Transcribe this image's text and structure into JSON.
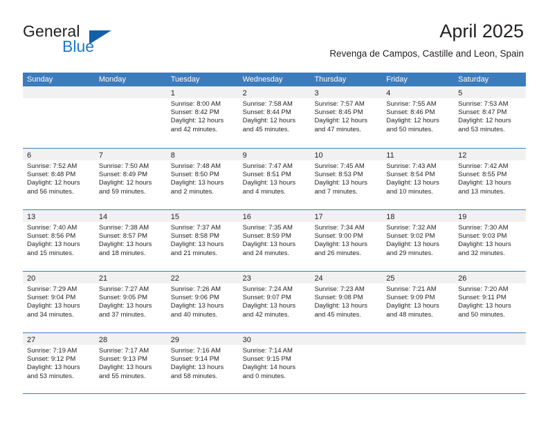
{
  "brand": {
    "name_part1": "General",
    "name_part2": "Blue",
    "triangle_icon": "triangle-icon",
    "accent_color": "#2079c4",
    "triangle_color": "#1260a8"
  },
  "header": {
    "title": "April 2025",
    "subtitle": "Revenga de Campos, Castille and Leon, Spain"
  },
  "theme": {
    "header_bg": "#3d7cbc",
    "header_text": "#ffffff",
    "daynum_band": "#f1f1f1",
    "border": "#3d7cbc"
  },
  "weekday_headers": [
    "Sunday",
    "Monday",
    "Tuesday",
    "Wednesday",
    "Thursday",
    "Friday",
    "Saturday"
  ],
  "weeks": [
    [
      {
        "day": "",
        "empty": true,
        "sunrise": "",
        "sunset": "",
        "daylight1": "",
        "daylight2": ""
      },
      {
        "day": "",
        "empty": true,
        "sunrise": "",
        "sunset": "",
        "daylight1": "",
        "daylight2": ""
      },
      {
        "day": "1",
        "empty": false,
        "sunrise": "Sunrise: 8:00 AM",
        "sunset": "Sunset: 8:42 PM",
        "daylight1": "Daylight: 12 hours",
        "daylight2": "and 42 minutes."
      },
      {
        "day": "2",
        "empty": false,
        "sunrise": "Sunrise: 7:58 AM",
        "sunset": "Sunset: 8:44 PM",
        "daylight1": "Daylight: 12 hours",
        "daylight2": "and 45 minutes."
      },
      {
        "day": "3",
        "empty": false,
        "sunrise": "Sunrise: 7:57 AM",
        "sunset": "Sunset: 8:45 PM",
        "daylight1": "Daylight: 12 hours",
        "daylight2": "and 47 minutes."
      },
      {
        "day": "4",
        "empty": false,
        "sunrise": "Sunrise: 7:55 AM",
        "sunset": "Sunset: 8:46 PM",
        "daylight1": "Daylight: 12 hours",
        "daylight2": "and 50 minutes."
      },
      {
        "day": "5",
        "empty": false,
        "sunrise": "Sunrise: 7:53 AM",
        "sunset": "Sunset: 8:47 PM",
        "daylight1": "Daylight: 12 hours",
        "daylight2": "and 53 minutes."
      }
    ],
    [
      {
        "day": "6",
        "empty": false,
        "sunrise": "Sunrise: 7:52 AM",
        "sunset": "Sunset: 8:48 PM",
        "daylight1": "Daylight: 12 hours",
        "daylight2": "and 56 minutes."
      },
      {
        "day": "7",
        "empty": false,
        "sunrise": "Sunrise: 7:50 AM",
        "sunset": "Sunset: 8:49 PM",
        "daylight1": "Daylight: 12 hours",
        "daylight2": "and 59 minutes."
      },
      {
        "day": "8",
        "empty": false,
        "sunrise": "Sunrise: 7:48 AM",
        "sunset": "Sunset: 8:50 PM",
        "daylight1": "Daylight: 13 hours",
        "daylight2": "and 2 minutes."
      },
      {
        "day": "9",
        "empty": false,
        "sunrise": "Sunrise: 7:47 AM",
        "sunset": "Sunset: 8:51 PM",
        "daylight1": "Daylight: 13 hours",
        "daylight2": "and 4 minutes."
      },
      {
        "day": "10",
        "empty": false,
        "sunrise": "Sunrise: 7:45 AM",
        "sunset": "Sunset: 8:53 PM",
        "daylight1": "Daylight: 13 hours",
        "daylight2": "and 7 minutes."
      },
      {
        "day": "11",
        "empty": false,
        "sunrise": "Sunrise: 7:43 AM",
        "sunset": "Sunset: 8:54 PM",
        "daylight1": "Daylight: 13 hours",
        "daylight2": "and 10 minutes."
      },
      {
        "day": "12",
        "empty": false,
        "sunrise": "Sunrise: 7:42 AM",
        "sunset": "Sunset: 8:55 PM",
        "daylight1": "Daylight: 13 hours",
        "daylight2": "and 13 minutes."
      }
    ],
    [
      {
        "day": "13",
        "empty": false,
        "sunrise": "Sunrise: 7:40 AM",
        "sunset": "Sunset: 8:56 PM",
        "daylight1": "Daylight: 13 hours",
        "daylight2": "and 15 minutes."
      },
      {
        "day": "14",
        "empty": false,
        "sunrise": "Sunrise: 7:38 AM",
        "sunset": "Sunset: 8:57 PM",
        "daylight1": "Daylight: 13 hours",
        "daylight2": "and 18 minutes."
      },
      {
        "day": "15",
        "empty": false,
        "sunrise": "Sunrise: 7:37 AM",
        "sunset": "Sunset: 8:58 PM",
        "daylight1": "Daylight: 13 hours",
        "daylight2": "and 21 minutes."
      },
      {
        "day": "16",
        "empty": false,
        "sunrise": "Sunrise: 7:35 AM",
        "sunset": "Sunset: 8:59 PM",
        "daylight1": "Daylight: 13 hours",
        "daylight2": "and 24 minutes."
      },
      {
        "day": "17",
        "empty": false,
        "sunrise": "Sunrise: 7:34 AM",
        "sunset": "Sunset: 9:00 PM",
        "daylight1": "Daylight: 13 hours",
        "daylight2": "and 26 minutes."
      },
      {
        "day": "18",
        "empty": false,
        "sunrise": "Sunrise: 7:32 AM",
        "sunset": "Sunset: 9:02 PM",
        "daylight1": "Daylight: 13 hours",
        "daylight2": "and 29 minutes."
      },
      {
        "day": "19",
        "empty": false,
        "sunrise": "Sunrise: 7:30 AM",
        "sunset": "Sunset: 9:03 PM",
        "daylight1": "Daylight: 13 hours",
        "daylight2": "and 32 minutes."
      }
    ],
    [
      {
        "day": "20",
        "empty": false,
        "sunrise": "Sunrise: 7:29 AM",
        "sunset": "Sunset: 9:04 PM",
        "daylight1": "Daylight: 13 hours",
        "daylight2": "and 34 minutes."
      },
      {
        "day": "21",
        "empty": false,
        "sunrise": "Sunrise: 7:27 AM",
        "sunset": "Sunset: 9:05 PM",
        "daylight1": "Daylight: 13 hours",
        "daylight2": "and 37 minutes."
      },
      {
        "day": "22",
        "empty": false,
        "sunrise": "Sunrise: 7:26 AM",
        "sunset": "Sunset: 9:06 PM",
        "daylight1": "Daylight: 13 hours",
        "daylight2": "and 40 minutes."
      },
      {
        "day": "23",
        "empty": false,
        "sunrise": "Sunrise: 7:24 AM",
        "sunset": "Sunset: 9:07 PM",
        "daylight1": "Daylight: 13 hours",
        "daylight2": "and 42 minutes."
      },
      {
        "day": "24",
        "empty": false,
        "sunrise": "Sunrise: 7:23 AM",
        "sunset": "Sunset: 9:08 PM",
        "daylight1": "Daylight: 13 hours",
        "daylight2": "and 45 minutes."
      },
      {
        "day": "25",
        "empty": false,
        "sunrise": "Sunrise: 7:21 AM",
        "sunset": "Sunset: 9:09 PM",
        "daylight1": "Daylight: 13 hours",
        "daylight2": "and 48 minutes."
      },
      {
        "day": "26",
        "empty": false,
        "sunrise": "Sunrise: 7:20 AM",
        "sunset": "Sunset: 9:11 PM",
        "daylight1": "Daylight: 13 hours",
        "daylight2": "and 50 minutes."
      }
    ],
    [
      {
        "day": "27",
        "empty": false,
        "sunrise": "Sunrise: 7:19 AM",
        "sunset": "Sunset: 9:12 PM",
        "daylight1": "Daylight: 13 hours",
        "daylight2": "and 53 minutes."
      },
      {
        "day": "28",
        "empty": false,
        "sunrise": "Sunrise: 7:17 AM",
        "sunset": "Sunset: 9:13 PM",
        "daylight1": "Daylight: 13 hours",
        "daylight2": "and 55 minutes."
      },
      {
        "day": "29",
        "empty": false,
        "sunrise": "Sunrise: 7:16 AM",
        "sunset": "Sunset: 9:14 PM",
        "daylight1": "Daylight: 13 hours",
        "daylight2": "and 58 minutes."
      },
      {
        "day": "30",
        "empty": false,
        "sunrise": "Sunrise: 7:14 AM",
        "sunset": "Sunset: 9:15 PM",
        "daylight1": "Daylight: 14 hours",
        "daylight2": "and 0 minutes."
      },
      {
        "day": "",
        "empty": true,
        "sunrise": "",
        "sunset": "",
        "daylight1": "",
        "daylight2": ""
      },
      {
        "day": "",
        "empty": true,
        "sunrise": "",
        "sunset": "",
        "daylight1": "",
        "daylight2": ""
      },
      {
        "day": "",
        "empty": true,
        "sunrise": "",
        "sunset": "",
        "daylight1": "",
        "daylight2": ""
      }
    ]
  ]
}
